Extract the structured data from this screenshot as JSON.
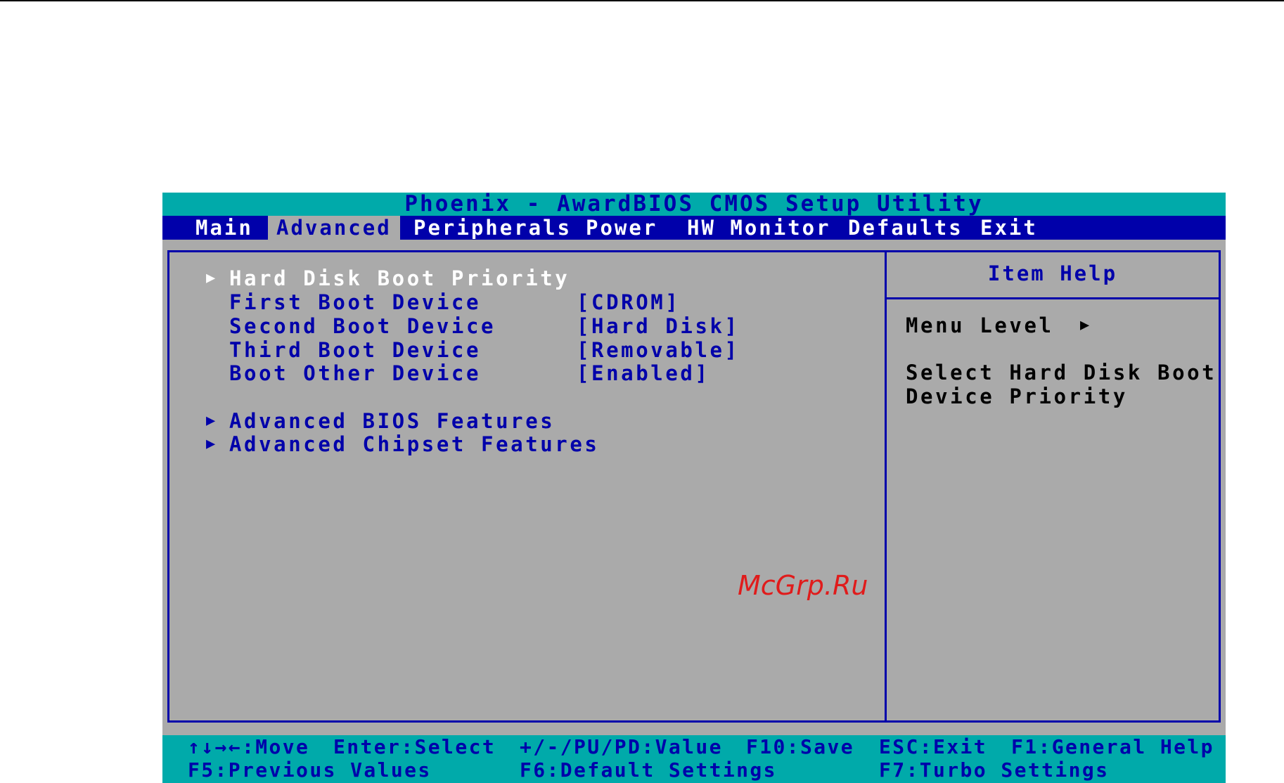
{
  "title": "Phoenix - AwardBIOS CMOS Setup Utility",
  "menu": [
    {
      "label": "Main",
      "active": false
    },
    {
      "label": "Advanced",
      "active": true
    },
    {
      "label": "Peripherals",
      "active": false
    },
    {
      "label": "Power",
      "active": false
    },
    {
      "label": "HW Monitor",
      "active": false
    },
    {
      "label": "Defaults",
      "active": false
    },
    {
      "label": "Exit",
      "active": false
    }
  ],
  "items": [
    {
      "label": "Hard Disk Boot Priority",
      "value": "",
      "submenu": true,
      "selected": true
    },
    {
      "label": "First Boot Device",
      "value": "[CDROM]",
      "submenu": false,
      "selected": false
    },
    {
      "label": "Second Boot Device",
      "value": "[Hard Disk]",
      "submenu": false,
      "selected": false
    },
    {
      "label": "Third Boot Device",
      "value": "[Removable]",
      "submenu": false,
      "selected": false
    },
    {
      "label": "Boot Other Device",
      "value": "[Enabled]",
      "submenu": false,
      "selected": false
    },
    {
      "label": "Advanced BIOS Features",
      "value": "",
      "submenu": true,
      "selected": false
    },
    {
      "label": "Advanced Chipset Features",
      "value": "",
      "submenu": true,
      "selected": false
    }
  ],
  "help": {
    "title": "Item Help",
    "menu_level_label": "Menu Level",
    "menu_level_arrow": "▶",
    "text_line1": "Select Hard Disk Boot",
    "text_line2": "Device Priority"
  },
  "submenu_arrow": "▶",
  "watermark": "McGrp.Ru",
  "status": {
    "line1": [
      "↑↓→←:Move",
      "Enter:Select",
      "+/-/PU/PD:Value",
      "F10:Save",
      "ESC:Exit",
      "F1:General Help"
    ],
    "line2": [
      "F5:Previous Values",
      "F6:Default Settings",
      "F7:Turbo Settings"
    ]
  },
  "colors": {
    "bios_blue": "#0000aa",
    "bios_cyan": "#00aaaa",
    "bios_gray": "#aaaaaa",
    "selected_text": "#ffffff",
    "watermark_red": "#e01b1b"
  }
}
